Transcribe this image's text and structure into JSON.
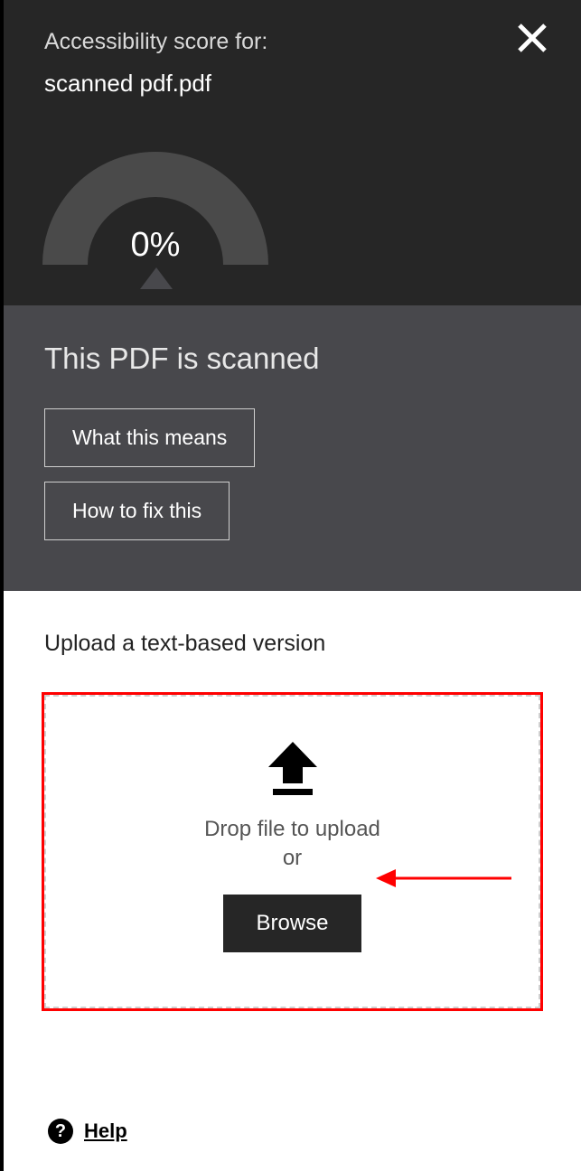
{
  "header": {
    "label": "Accessibility score for:",
    "filename": "scanned pdf.pdf",
    "score_display": "0%",
    "score_percent": 0
  },
  "message": {
    "heading": "This PDF is scanned",
    "btn_what": "What this means",
    "btn_fix": "How to fix this"
  },
  "upload": {
    "heading": "Upload a text-based version",
    "drop_text": "Drop file to upload",
    "or_text": "or",
    "browse_label": "Browse"
  },
  "help": {
    "label": "Help"
  }
}
